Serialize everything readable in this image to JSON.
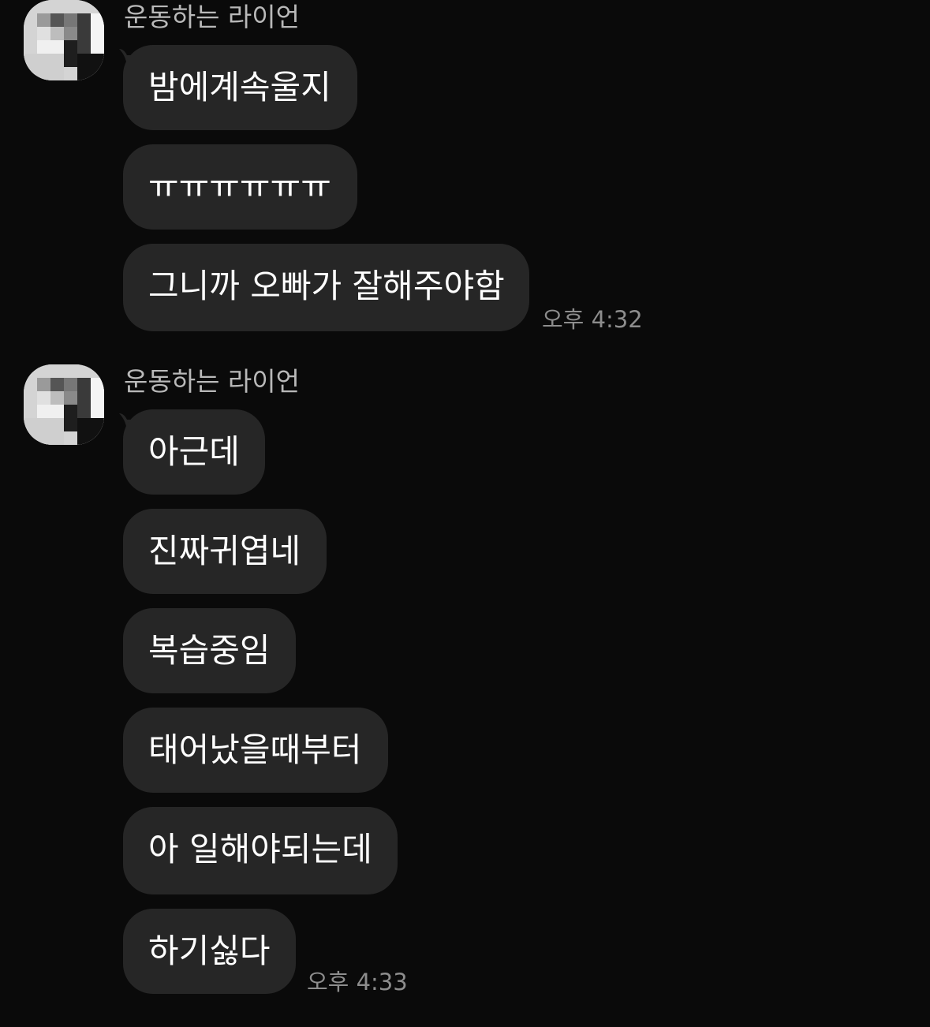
{
  "colors": {
    "background": "#0a0a0a",
    "bubble": "#262626",
    "sender_name": "#b9b9b9",
    "timestamp": "#8d8d8d",
    "message_text": "#ffffff"
  },
  "groups": [
    {
      "sender": "운동하는 라이언",
      "avatar": "blurred-profile-avatar",
      "messages": [
        "밤에계속울지",
        "ㅠㅠㅠㅠㅠㅠ",
        "그니까 오빠가 잘해주야함"
      ],
      "time": "오후 4:32"
    },
    {
      "sender": "운동하는 라이언",
      "avatar": "blurred-profile-avatar",
      "messages": [
        "아근데",
        "진짜귀엽네",
        "복습중임",
        "태어났을때부터",
        "아 일해야되는데",
        "하기싫다"
      ],
      "time": "오후 4:33"
    }
  ]
}
